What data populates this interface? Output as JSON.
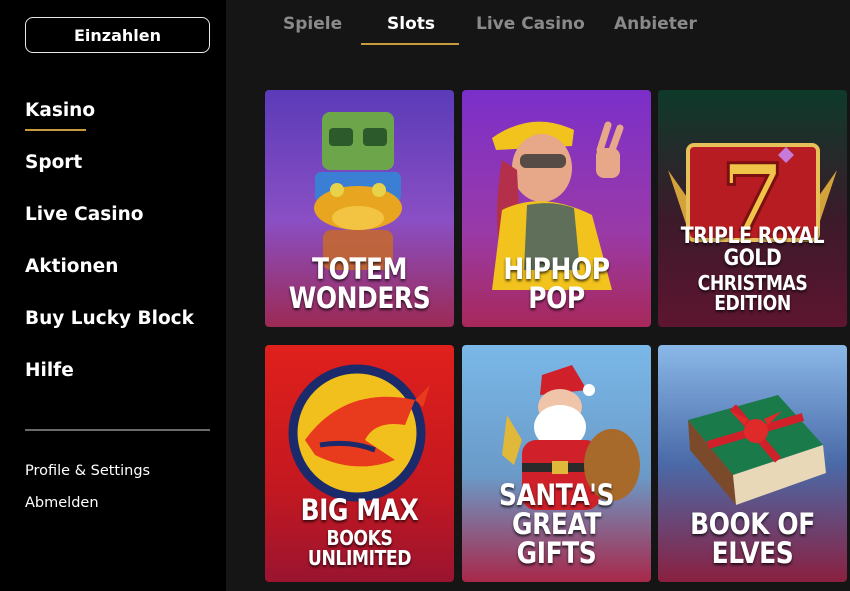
{
  "sidebar": {
    "deposit_label": "Einzahlen",
    "nav": [
      {
        "label": "Kasino",
        "active": true
      },
      {
        "label": "Sport"
      },
      {
        "label": "Live Casino"
      },
      {
        "label": "Aktionen"
      },
      {
        "label": "Buy Lucky Block"
      },
      {
        "label": "Hilfe"
      }
    ],
    "sub_nav": [
      {
        "label": "Profile & Settings"
      },
      {
        "label": "Abmelden"
      }
    ]
  },
  "tabs": [
    {
      "label": "Spiele"
    },
    {
      "label": "Slots",
      "active": true
    },
    {
      "label": "Live Casino"
    },
    {
      "label": "Anbieter"
    }
  ],
  "games": [
    {
      "line1": "TOTEM WONDERS",
      "line2": ""
    },
    {
      "line1": "HIPHOP POP",
      "line2": ""
    },
    {
      "line1": "TRIPLE ROYAL GOLD",
      "line2": "CHRISTMAS EDITION"
    },
    {
      "line1": "BIG MAX",
      "line2": "BOOKS UNLIMITED"
    },
    {
      "line1": "SANTA'S",
      "line2": "GREAT GIFTS"
    },
    {
      "line1": "BOOK OF ELVES",
      "line2": ""
    }
  ],
  "colors": {
    "accent": "#c79a3b",
    "sidebar_bg": "#000000",
    "main_bg": "#151515",
    "tab_inactive": "#8a8a8a"
  }
}
